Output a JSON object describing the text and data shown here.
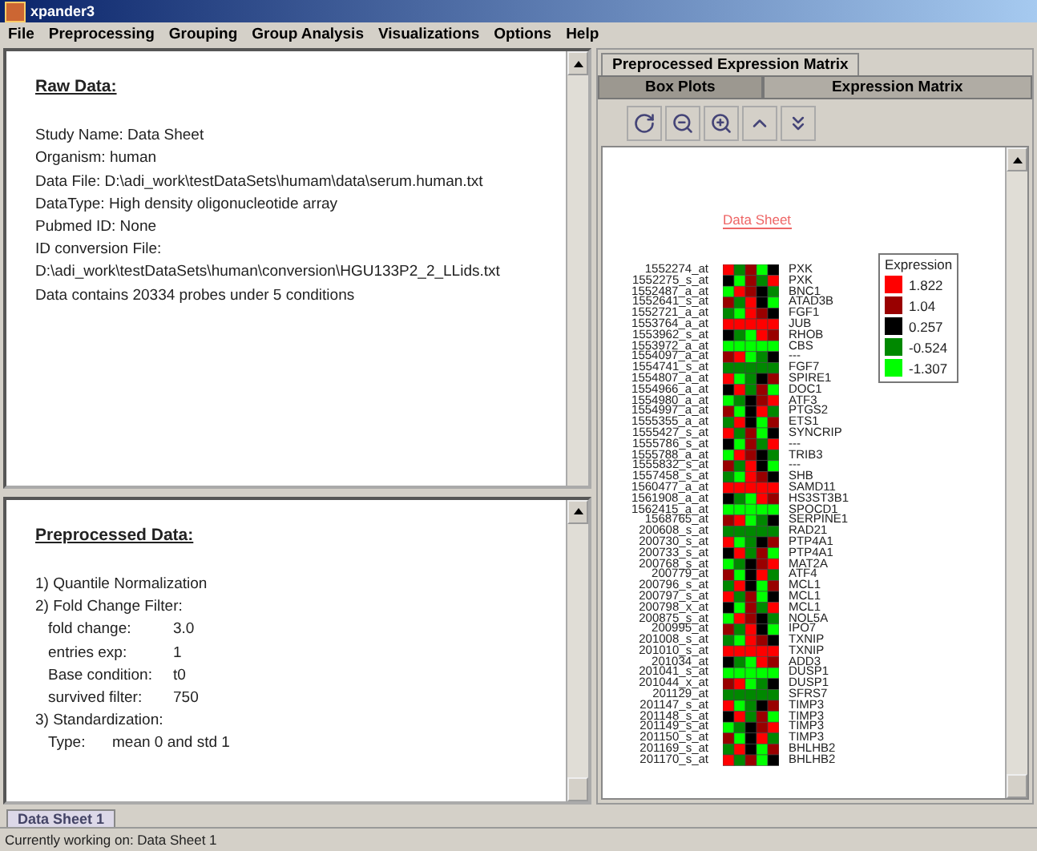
{
  "window": {
    "title": "xpander3"
  },
  "menu": [
    "File",
    "Preprocessing",
    "Grouping",
    "Group Analysis",
    "Visualizations",
    "Options",
    "Help"
  ],
  "raw_data": {
    "heading": "Raw Data:",
    "lines": [
      {
        "label": "Study Name:",
        "value": "Data Sheet"
      },
      {
        "label": "Organism:",
        "value": "human"
      },
      {
        "label": "Data File:",
        "value": "D:\\adi_work\\testDataSets\\humam\\data\\serum.human.txt"
      },
      {
        "label": "DataType:",
        "value": "High density oligonucleotide array"
      },
      {
        "label": "Pubmed ID:",
        "value": "None"
      },
      {
        "label": "ID conversion File:"
      }
    ],
    "extra": [
      "D:\\adi_work\\testDataSets\\human\\conversion\\HGU133P2_2_LLids.txt",
      "Data contains 20334 probes under 5 conditions"
    ]
  },
  "preprocessed": {
    "heading": "Preprocessed Data:",
    "items": [
      {
        "kind": "step",
        "text": "1) Quantile Normalization"
      },
      {
        "kind": "step",
        "text": "2) Fold Change Filter:"
      },
      {
        "kind": "param",
        "label": "fold change:",
        "value": "3.0"
      },
      {
        "kind": "param",
        "label": "entries exp:",
        "value": "1"
      },
      {
        "kind": "param",
        "label": "Base condition:",
        "value": "t0"
      },
      {
        "kind": "param",
        "label": "survived filter:",
        "value": "750"
      },
      {
        "kind": "step",
        "text": "3) Standardization:"
      },
      {
        "kind": "type",
        "label": "Type:",
        "value": "mean 0 and std 1"
      }
    ]
  },
  "right_tab": "Preprocessed Expression Matrix",
  "sub_tabs": [
    {
      "label": "Box Plots",
      "selected": false
    },
    {
      "label": "Expression Matrix",
      "selected": true
    }
  ],
  "matrix": {
    "title": "Data Sheet",
    "legend": {
      "title": "Expression",
      "items": [
        {
          "label": "1.822",
          "color": "#ff0000"
        },
        {
          "label": "1.04",
          "color": "#990000"
        },
        {
          "label": "0.257",
          "color": "#000000"
        },
        {
          "label": "-0.524",
          "color": "#008800"
        },
        {
          "label": "-1.307",
          "color": "#00ff00"
        }
      ]
    },
    "rows": [
      {
        "probe": "1552274_at",
        "gene": "PXK"
      },
      {
        "probe": "1552275_s_at",
        "gene": "PXK"
      },
      {
        "probe": "1552487_a_at",
        "gene": "BNC1"
      },
      {
        "probe": "1552641_s_at",
        "gene": "ATAD3B"
      },
      {
        "probe": "1552721_a_at",
        "gene": "FGF1"
      },
      {
        "probe": "1553764_a_at",
        "gene": "JUB"
      },
      {
        "probe": "1553962_s_at",
        "gene": "RHOB"
      },
      {
        "probe": "1553972_a_at",
        "gene": "CBS"
      },
      {
        "probe": "1554097_a_at",
        "gene": "---"
      },
      {
        "probe": "1554741_s_at",
        "gene": "FGF7"
      },
      {
        "probe": "1554807_a_at",
        "gene": "SPIRE1"
      },
      {
        "probe": "1554966_a_at",
        "gene": "DOC1"
      },
      {
        "probe": "1554980_a_at",
        "gene": "ATF3"
      },
      {
        "probe": "1554997_a_at",
        "gene": "PTGS2"
      },
      {
        "probe": "1555355_a_at",
        "gene": "ETS1"
      },
      {
        "probe": "1555427_s_at",
        "gene": "SYNCRIP"
      },
      {
        "probe": "1555786_s_at",
        "gene": "---"
      },
      {
        "probe": "1555788_a_at",
        "gene": "TRIB3"
      },
      {
        "probe": "1555832_s_at",
        "gene": "---"
      },
      {
        "probe": "1557458_s_at",
        "gene": "SHB"
      },
      {
        "probe": "1560477_a_at",
        "gene": "SAMD11"
      },
      {
        "probe": "1561908_a_at",
        "gene": "HS3ST3B1"
      },
      {
        "probe": "1562415_a_at",
        "gene": "SPOCD1"
      },
      {
        "probe": "1568765_at",
        "gene": "SERPINE1"
      },
      {
        "probe": "200608_s_at",
        "gene": "RAD21"
      },
      {
        "probe": "200730_s_at",
        "gene": "PTP4A1"
      },
      {
        "probe": "200733_s_at",
        "gene": "PTP4A1"
      },
      {
        "probe": "200768_s_at",
        "gene": "MAT2A"
      },
      {
        "probe": "200779_at",
        "gene": "ATF4"
      },
      {
        "probe": "200796_s_at",
        "gene": "MCL1"
      },
      {
        "probe": "200797_s_at",
        "gene": "MCL1"
      },
      {
        "probe": "200798_x_at",
        "gene": "MCL1"
      },
      {
        "probe": "200875_s_at",
        "gene": "NOL5A"
      },
      {
        "probe": "200995_at",
        "gene": "IPO7"
      },
      {
        "probe": "201008_s_at",
        "gene": "TXNIP"
      },
      {
        "probe": "201010_s_at",
        "gene": "TXNIP"
      },
      {
        "probe": "201034_at",
        "gene": "ADD3"
      },
      {
        "probe": "201041_s_at",
        "gene": "DUSP1"
      },
      {
        "probe": "201044_x_at",
        "gene": "DUSP1"
      },
      {
        "probe": "201129_at",
        "gene": "SFRS7"
      },
      {
        "probe": "201147_s_at",
        "gene": "TIMP3"
      },
      {
        "probe": "201148_s_at",
        "gene": "TIMP3"
      },
      {
        "probe": "201149_s_at",
        "gene": "TIMP3"
      },
      {
        "probe": "201150_s_at",
        "gene": "TIMP3"
      },
      {
        "probe": "201169_s_at",
        "gene": "BHLHB2"
      },
      {
        "probe": "201170_s_at",
        "gene": "BHLHB2"
      }
    ]
  },
  "bottom_tabs": [
    {
      "label": "Data Sheet 1",
      "selected": true
    }
  ],
  "status_bar": "Currently working on: Data Sheet 1"
}
